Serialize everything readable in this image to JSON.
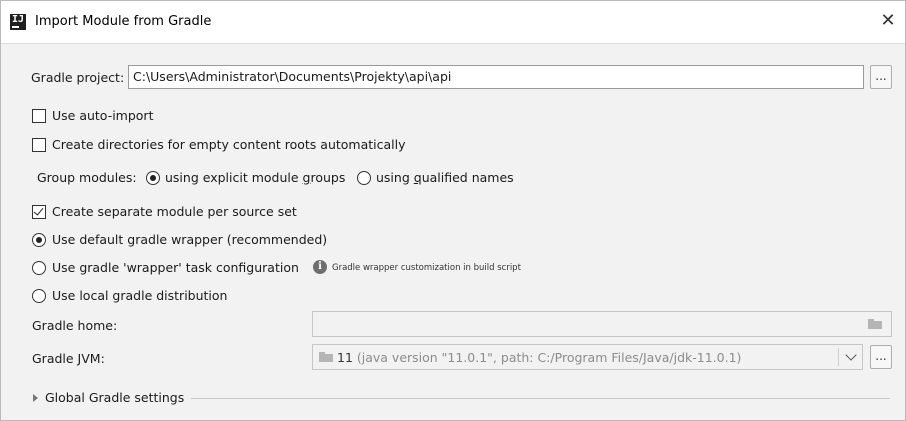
{
  "window": {
    "title": "Import Module from Gradle",
    "close_glyph": "✕"
  },
  "gradle_project": {
    "label": "Gradle project:",
    "value": "C:\\Users\\Administrator\\Documents\\Projekty\\api\\api",
    "browse_label": "..."
  },
  "options": {
    "auto_import": {
      "label": "Use auto-import",
      "checked": false
    },
    "create_dirs": {
      "label": "Create directories for empty content roots automatically",
      "checked": false
    }
  },
  "group_modules": {
    "label": "Group modules:",
    "explicit": {
      "pre": "using explicit module ",
      "mnemonic": "g",
      "post": "roups",
      "selected": true
    },
    "qualified": {
      "pre": "using ",
      "mnemonic": "q",
      "post": "ualified names",
      "selected": false
    }
  },
  "separate_module": {
    "label": "Create separate module per source set",
    "checked": true
  },
  "distribution": {
    "default_wrapper": {
      "label": "Use default gradle wrapper (recommended)",
      "selected": true
    },
    "wrapper_task": {
      "label": "Use gradle 'wrapper' task configuration",
      "selected": false,
      "hint": "Gradle wrapper customization in build script"
    },
    "local": {
      "label": "Use local gradle distribution",
      "selected": false
    }
  },
  "gradle_home": {
    "label": "Gradle home:",
    "value": ""
  },
  "gradle_jvm": {
    "label": "Gradle JVM:",
    "version": "11",
    "detail": " (java version \"11.0.1\", path: C:/Program Files/Java/jdk-11.0.1)",
    "browse_label": "..."
  },
  "global_settings": {
    "label": "Global Gradle settings"
  },
  "icons": {
    "app": "intellij-icon",
    "folder": "folder-icon",
    "info": "info-icon",
    "chevron": "chevron-down-icon",
    "expand": "triangle-right-icon"
  }
}
